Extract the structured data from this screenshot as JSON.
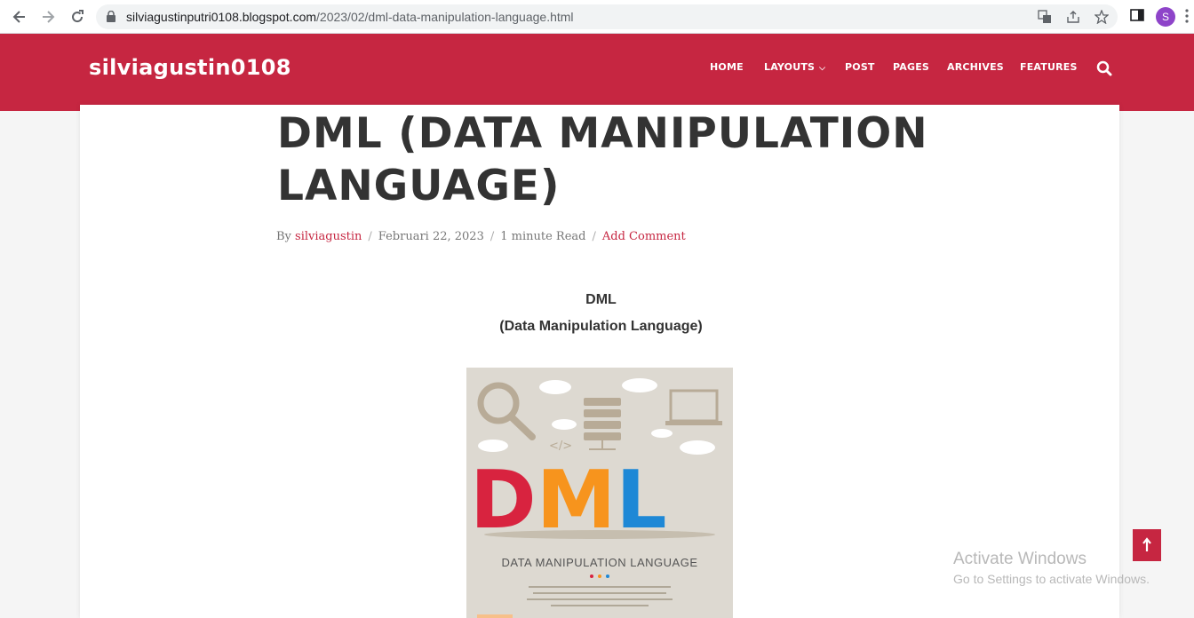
{
  "browser": {
    "url_host": "silviagustinputri0108.blogspot.com",
    "url_path": "/2023/02/dml-data-manipulation-language.html",
    "profile_initial": "S",
    "icons": [
      "back-icon",
      "forward-icon",
      "reload-icon",
      "lock-icon",
      "translate-icon",
      "share-icon",
      "star-icon",
      "side-panel-icon",
      "menu-icon"
    ]
  },
  "site": {
    "title": "silviagustin0108",
    "brand_color": "#c62641",
    "menu": [
      {
        "label": "HOME"
      },
      {
        "label": "LAYOUTS",
        "has_dropdown": true
      },
      {
        "label": "POST"
      },
      {
        "label": "PAGES"
      },
      {
        "label": "ARCHIVES"
      },
      {
        "label": "FEATURES"
      }
    ]
  },
  "post": {
    "title": "DML (DATA MANIPULATION LANGUAGE)",
    "meta": {
      "by": "By",
      "author": "silviagustin",
      "date": "Februari 22, 2023",
      "read_time": "1 minute Read",
      "comment_link": "Add Comment",
      "separator": "/"
    },
    "heading1": "DML",
    "heading2": "(Data Manipulation Language)",
    "image": {
      "big_text": "DML",
      "caption": "DATA MANIPULATION LANGUAGE"
    }
  },
  "windows": {
    "activate_title": "Activate Windows",
    "activate_sub": "Go to Settings to activate Windows."
  }
}
